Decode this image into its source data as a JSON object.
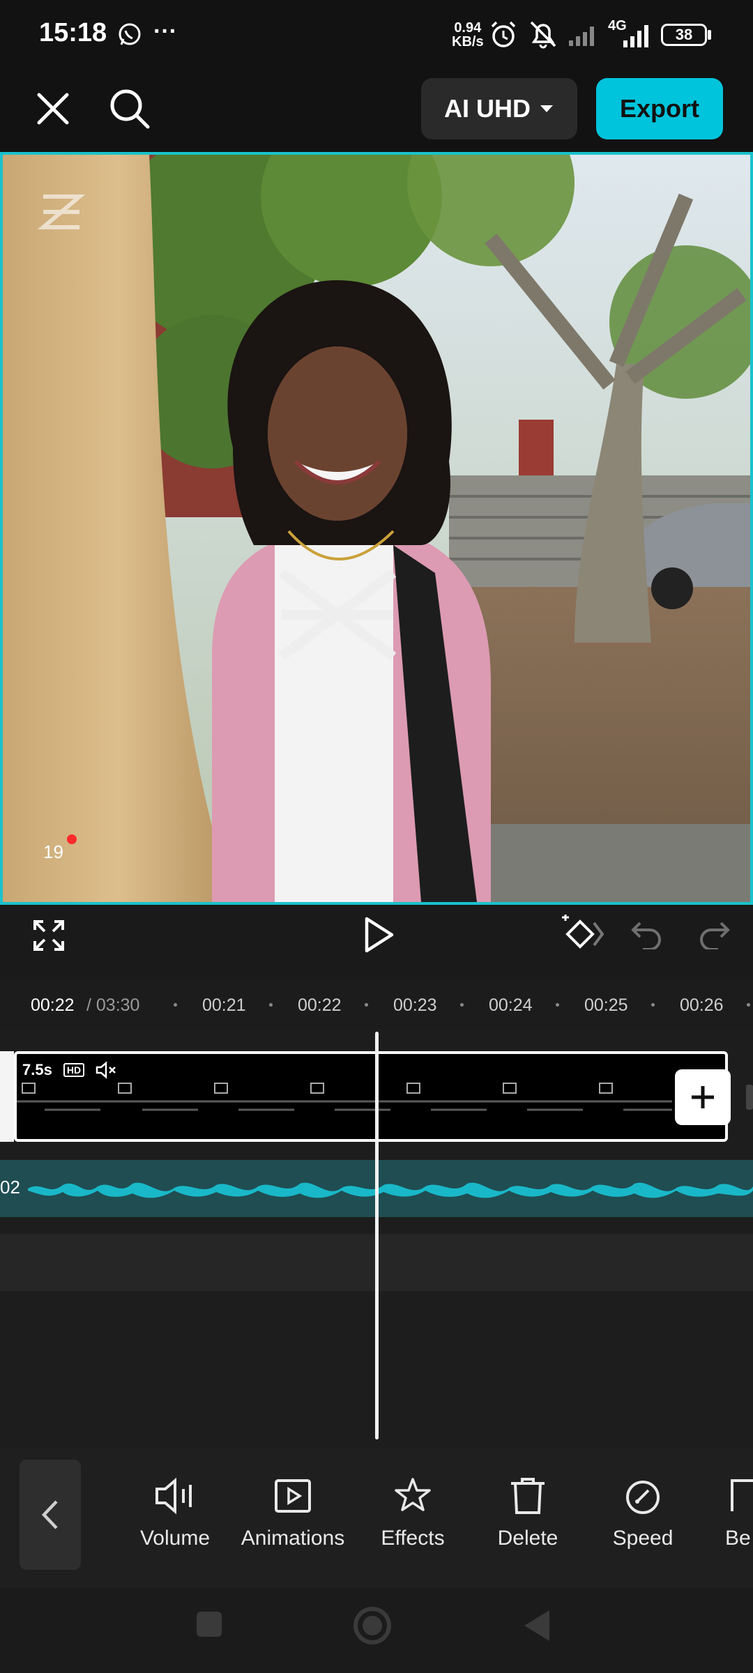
{
  "status": {
    "time": "15:18",
    "net_speed_top": "0.94",
    "net_speed_bottom": "KB/s",
    "network": "4G",
    "battery": "38"
  },
  "topbar": {
    "resolution_label": "AI UHD",
    "export_label": "Export"
  },
  "preview": {
    "frame_counter": "19"
  },
  "timeline": {
    "current_time": "00:22",
    "total_time": "/ 03:30",
    "ticks": [
      "00:21",
      "00:22",
      "00:23",
      "00:24",
      "00:25",
      "00:26"
    ],
    "clip_duration": "7.5s",
    "clip_hd": "HD",
    "audio_label": "02"
  },
  "toolbar": {
    "items": [
      {
        "label": "Volume",
        "icon": "volume-icon"
      },
      {
        "label": "Animations",
        "icon": "animations-icon"
      },
      {
        "label": "Effects",
        "icon": "effects-icon"
      },
      {
        "label": "Delete",
        "icon": "delete-icon"
      },
      {
        "label": "Speed",
        "icon": "speed-icon"
      },
      {
        "label": "Be",
        "icon": "beats-icon"
      }
    ]
  },
  "colors": {
    "accent": "#00c4dc",
    "audio_wave": "#19b8c8",
    "audio_bg": "#1f4d52"
  }
}
